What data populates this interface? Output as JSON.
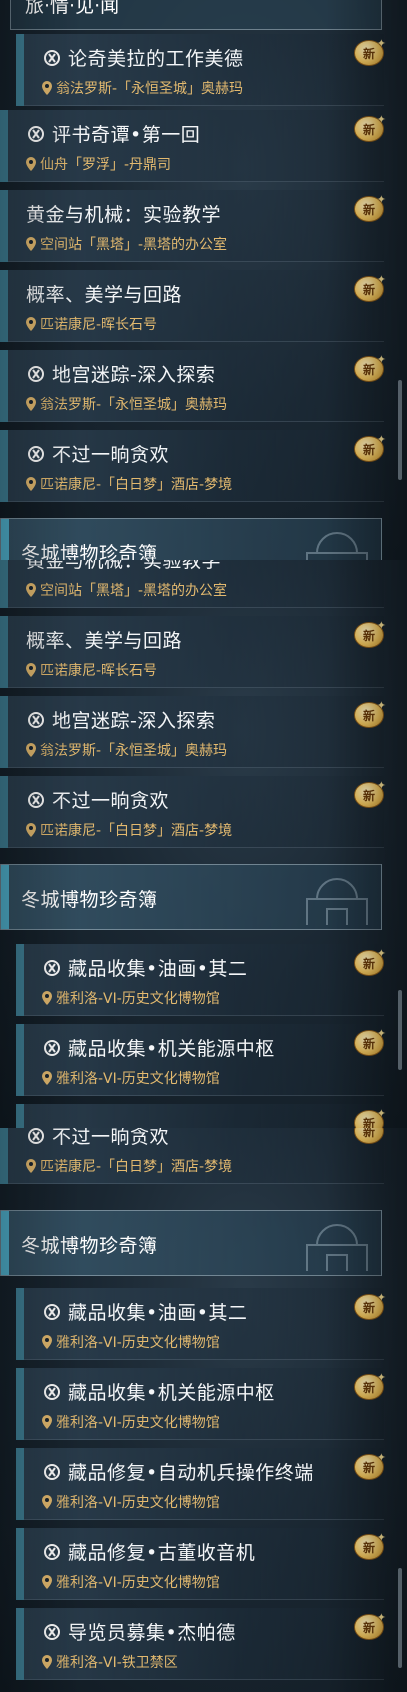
{
  "badge_text": "新",
  "screens": [
    {
      "fragments": {
        "top_header_partial": "旅·情·见·闻"
      },
      "quests": [
        {
          "title": "论奇美拉的工作美德",
          "location": "翁法罗斯-「永恒圣城」奥赫玛",
          "has_icon": true
        },
        {
          "title": "评书奇谭•第一回",
          "location": "仙舟「罗浮」-丹鼎司",
          "has_icon": true
        },
        {
          "title": "黄金与机械：实验教学",
          "location": "空间站「黑塔」-黑塔的办公室",
          "has_icon": false
        },
        {
          "title": "概率、美学与回路",
          "location": "匹诺康尼-晖长石号",
          "has_icon": false
        },
        {
          "title": "地宫迷踪-深入探索",
          "location": "翁法罗斯-「永恒圣城」奥赫玛",
          "has_icon": true
        },
        {
          "title": "不过一晌贪欢",
          "location": "匹诺康尼-「白日梦」酒店-梦境",
          "has_icon": true
        }
      ],
      "category_partial": "冬城博物珍奇簿"
    },
    {
      "fragments": {
        "top_title_partial": "黄金与机械：实验教学"
      },
      "quests": [
        {
          "title": "黄金与机械：实验教学",
          "location": "空间站「黑塔」-黑塔的办公室",
          "has_icon": false
        },
        {
          "title": "概率、美学与回路",
          "location": "匹诺康尼-晖长石号",
          "has_icon": false
        },
        {
          "title": "地宫迷踪-深入探索",
          "location": "翁法罗斯-「永恒圣城」奥赫玛",
          "has_icon": true
        },
        {
          "title": "不过一晌贪欢",
          "location": "匹诺康尼-「白日梦」酒店-梦境",
          "has_icon": true
        }
      ],
      "category": "冬城博物珍奇簿",
      "sub_quests": [
        {
          "title": "藏品收集•油画•其二",
          "location": "雅利洛-VI-历史文化博物馆"
        },
        {
          "title": "藏品收集•机关能源中枢",
          "location": "雅利洛-VI-历史文化博物馆"
        }
      ]
    },
    {
      "quests": [
        {
          "title": "不过一晌贪欢",
          "location": "匹诺康尼-「白日梦」酒店-梦境",
          "has_icon": true
        }
      ],
      "category": "冬城博物珍奇簿",
      "sub_quests": [
        {
          "title": "藏品收集•油画•其二",
          "location": "雅利洛-VI-历史文化博物馆"
        },
        {
          "title": "藏品收集•机关能源中枢",
          "location": "雅利洛-VI-历史文化博物馆"
        },
        {
          "title": "藏品修复•自动机兵操作终端",
          "location": "雅利洛-VI-历史文化博物馆"
        },
        {
          "title": "藏品修复•古董收音机",
          "location": "雅利洛-VI-历史文化博物馆"
        },
        {
          "title": "导览员募集•杰帕德",
          "location": "雅利洛-VI-铁卫禁区"
        }
      ]
    }
  ]
}
